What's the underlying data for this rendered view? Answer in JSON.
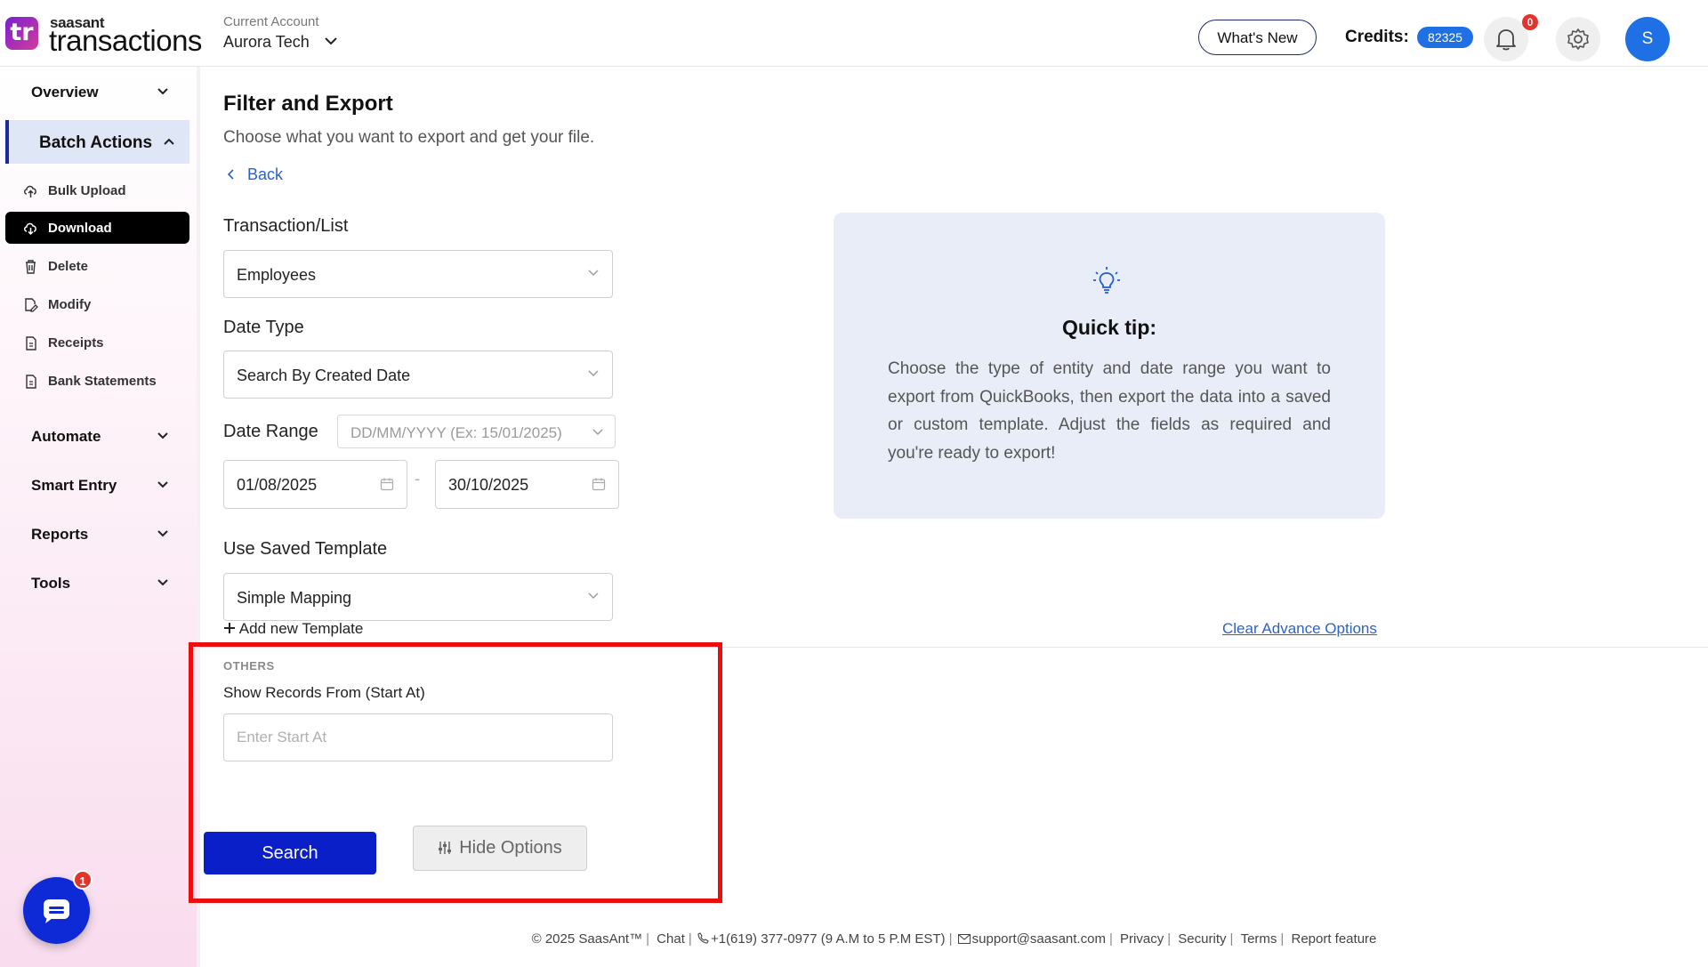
{
  "header": {
    "logo_badge": "tr",
    "logo_small": "saasant",
    "logo_big": "transactions",
    "account_label": "Current Account",
    "account_name": "Aurora Tech",
    "whats_new": "What's New",
    "credits_label": "Credits:",
    "credits_value": "82325",
    "notification_count": "0",
    "avatar_initial": "S"
  },
  "sidebar": {
    "sections": [
      {
        "label": "Overview"
      },
      {
        "label": "Batch Actions"
      },
      {
        "label": "Automate"
      },
      {
        "label": "Smart Entry"
      },
      {
        "label": "Reports"
      },
      {
        "label": "Tools"
      }
    ],
    "batch_items": [
      {
        "label": "Bulk Upload",
        "icon": "upload-cloud-icon"
      },
      {
        "label": "Download",
        "icon": "download-cloud-icon"
      },
      {
        "label": "Delete",
        "icon": "trash-icon"
      },
      {
        "label": "Modify",
        "icon": "edit-file-icon"
      },
      {
        "label": "Receipts",
        "icon": "receipt-icon"
      },
      {
        "label": "Bank Statements",
        "icon": "statement-icon"
      }
    ],
    "chat_badge": "1"
  },
  "main": {
    "title": "Filter and Export",
    "subtitle": "Choose what you want to export and get your file.",
    "back": "Back",
    "transaction_label": "Transaction/List",
    "transaction_value": "Employees",
    "date_type_label": "Date Type",
    "date_type_value": "Search By Created Date",
    "date_range_label": "Date Range",
    "date_range_placeholder": "DD/MM/YYYY (Ex: 15/01/2025)",
    "date_from": "01/08/2025",
    "date_sep": "-",
    "date_to": "30/10/2025",
    "template_label": "Use Saved Template",
    "template_value": "Simple Mapping",
    "add_template": "Add new Template",
    "clear_advanced": "Clear Advance Options",
    "others_label": "OTHERS",
    "start_at_label": "Show Records From (Start At)",
    "start_at_placeholder": "Enter Start At",
    "search_button": "Search",
    "hide_options_button": "Hide Options"
  },
  "tip": {
    "title": "Quick tip:",
    "body": "Choose the type of entity and date range you want to export from QuickBooks, then export the data into a saved or custom template. Adjust the fields as required and you're ready to export!"
  },
  "footer": {
    "copyright": "© 2025 SaasAnt™",
    "chat": "Chat",
    "phone": "+1(619) 377-0977 (9 A.M to 5 P.M EST)",
    "email": "support@saasant.com",
    "privacy": "Privacy",
    "security": "Security",
    "terms": "Terms",
    "report": "Report feature"
  },
  "colors": {
    "accent": "#0a1fc7",
    "link": "#2c62c9",
    "highlight": "#ee0d0d"
  }
}
